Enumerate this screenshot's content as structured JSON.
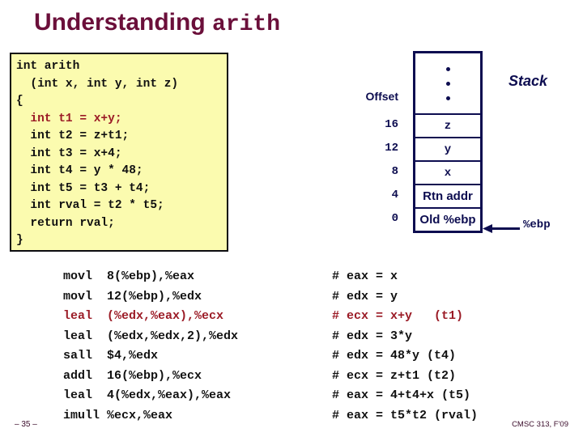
{
  "slide": {
    "title_main": "Understanding ",
    "title_mono": "arith",
    "footer_page": "– 35 –",
    "footer_course": "CMSC 313, F'09"
  },
  "colors": {
    "title": "#6B0F3A",
    "code_bg": "#FBFBAF",
    "code_border": "#0B0B10",
    "highlight_red": "#9B1B26",
    "stack_navy": "#0D0D50",
    "body_text": "#111111"
  },
  "code_box": {
    "lines": [
      {
        "text": "int arith",
        "highlight": false
      },
      {
        "text": "  (int x, int y, int z)",
        "highlight": false
      },
      {
        "text": "{",
        "highlight": false
      },
      {
        "text": "  int t1 = x+y;",
        "highlight": true
      },
      {
        "text": "  int t2 = z+t1;",
        "highlight": false
      },
      {
        "text": "  int t3 = x+4;",
        "highlight": false
      },
      {
        "text": "  int t4 = y * 48;",
        "highlight": false
      },
      {
        "text": "  int t5 = t3 + t4;",
        "highlight": false
      },
      {
        "text": "  int rval = t2 * t5;",
        "highlight": false
      },
      {
        "text": "  return rval;",
        "highlight": false
      },
      {
        "text": "}",
        "highlight": false
      }
    ]
  },
  "stack": {
    "title": "Stack",
    "offset_header": "Offset",
    "ebp_pointer_label": "%ebp",
    "dots_count": 3,
    "rows": [
      {
        "offset": "16",
        "value": "z",
        "bold_sans": false
      },
      {
        "offset": "12",
        "value": "y",
        "bold_sans": false
      },
      {
        "offset": "8",
        "value": "x",
        "bold_sans": false
      },
      {
        "offset": "4",
        "value": "Rtn addr",
        "bold_sans": true
      },
      {
        "offset": "0",
        "value": "Old %ebp",
        "bold_sans": true
      }
    ]
  },
  "assembly": {
    "lines": [
      {
        "instruction": "movl  8(%ebp),%eax",
        "comment": "# eax = x",
        "highlight": false
      },
      {
        "instruction": "movl  12(%ebp),%edx",
        "comment": "# edx = y",
        "highlight": false
      },
      {
        "instruction": "leal  (%edx,%eax),%ecx",
        "comment": "# ecx = x+y   (t1)",
        "highlight": true
      },
      {
        "instruction": "leal  (%edx,%edx,2),%edx",
        "comment": "# edx = 3*y",
        "highlight": false
      },
      {
        "instruction": "sall  $4,%edx",
        "comment": "# edx = 48*y (t4)",
        "highlight": false
      },
      {
        "instruction": "addl  16(%ebp),%ecx",
        "comment": "# ecx = z+t1 (t2)",
        "highlight": false
      },
      {
        "instruction": "leal  4(%edx,%eax),%eax",
        "comment": "# eax = 4+t4+x (t5)",
        "highlight": false
      },
      {
        "instruction": "imull %ecx,%eax",
        "comment": "# eax = t5*t2 (rval)",
        "highlight": false
      }
    ]
  }
}
